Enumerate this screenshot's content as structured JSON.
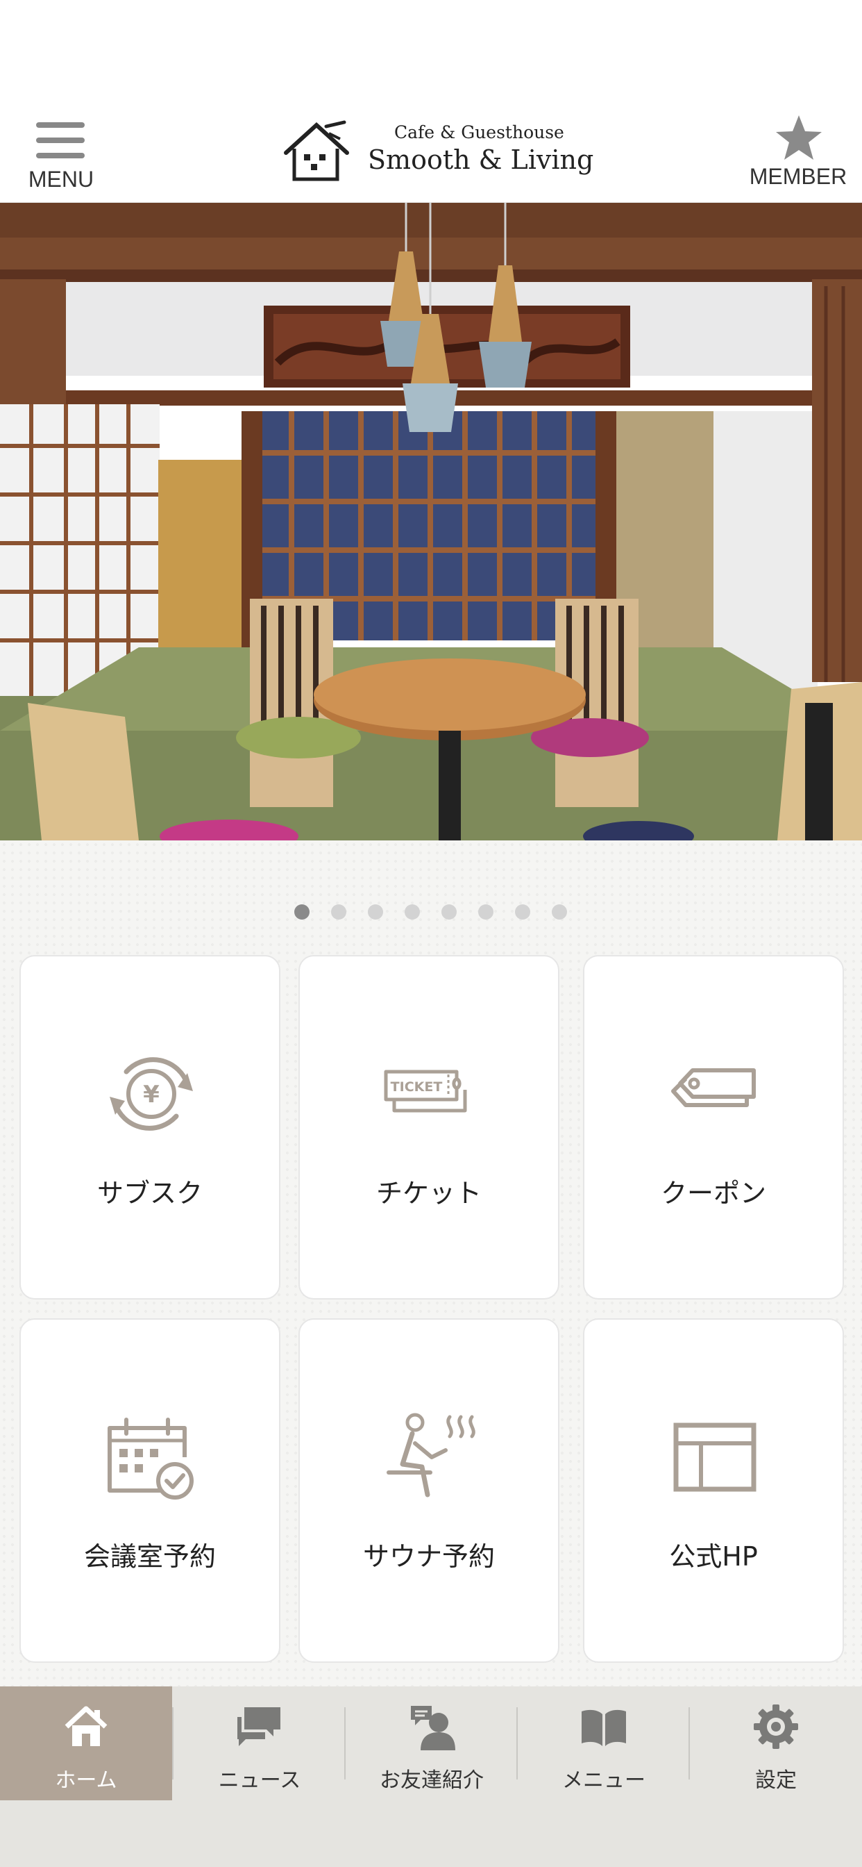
{
  "header": {
    "menu_label": "MENU",
    "member_label": "MEMBER",
    "logo_sub": "Cafe & Guesthouse",
    "logo_main": "Smooth & Living"
  },
  "carousel": {
    "slide_count": 8,
    "active_index": 0
  },
  "tiles": [
    {
      "label": "サブスク",
      "icon": "yen-cycle-icon"
    },
    {
      "label": "チケット",
      "icon": "ticket-icon",
      "icon_text": "TICKET"
    },
    {
      "label": "クーポン",
      "icon": "tag-icon"
    },
    {
      "label": "会議室予約",
      "icon": "calendar-check-icon"
    },
    {
      "label": "サウナ予約",
      "icon": "sauna-icon"
    },
    {
      "label": "公式HP",
      "icon": "webpage-icon"
    }
  ],
  "tabbar": {
    "items": [
      {
        "label": "ホーム",
        "icon": "home-icon",
        "active": true
      },
      {
        "label": "ニュース",
        "icon": "chat-bubbles-icon",
        "active": false
      },
      {
        "label": "お友達紹介",
        "icon": "friend-referral-icon",
        "active": false
      },
      {
        "label": "メニュー",
        "icon": "open-book-icon",
        "active": false
      },
      {
        "label": "設定",
        "icon": "gear-icon",
        "active": false
      }
    ]
  },
  "colors": {
    "icon_taupe": "#aaa096",
    "tab_active_bg": "#b1a497",
    "tab_bg": "#e5e4e0",
    "tab_icon": "#7a7a78"
  }
}
